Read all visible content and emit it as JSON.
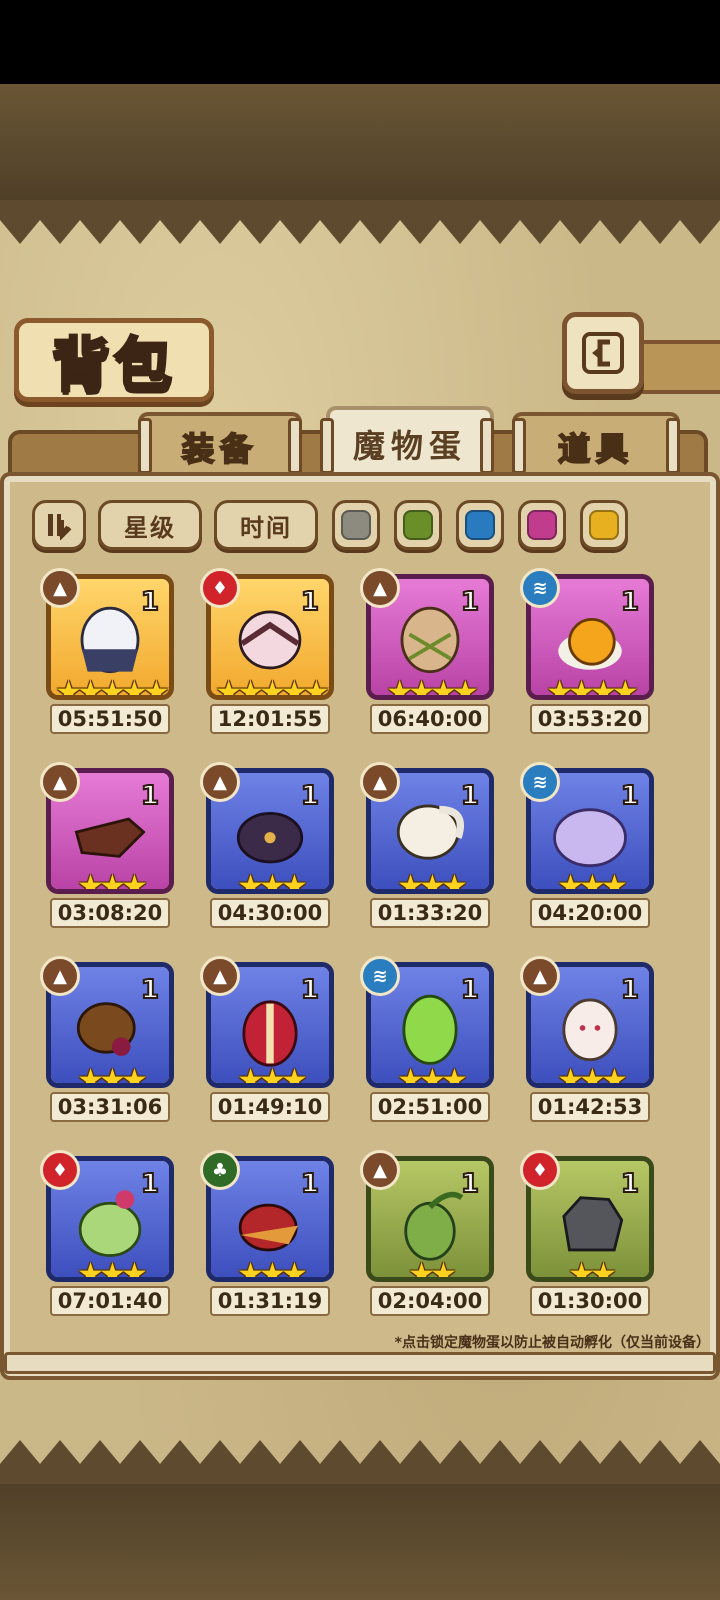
{
  "title": "背包",
  "tabs": [
    {
      "label": "装备",
      "active": false
    },
    {
      "label": "魔物蛋",
      "active": true
    },
    {
      "label": "道具",
      "active": false
    }
  ],
  "filters": {
    "sort_icon": "sort-toggle-icon",
    "star_label": "星级",
    "time_label": "时间",
    "color_swatches": [
      "#8d8a80",
      "#6b8f28",
      "#2a7ac0",
      "#c23c8e",
      "#e6b020"
    ]
  },
  "eggs": [
    {
      "element": "earth",
      "rarity": "gold",
      "count": "1",
      "stars": "★★★★★",
      "timer": "05:51:50"
    },
    {
      "element": "fire",
      "rarity": "gold",
      "count": "1",
      "stars": "★★★★★",
      "timer": "12:01:55"
    },
    {
      "element": "earth",
      "rarity": "purple",
      "count": "1",
      "stars": "★★★★",
      "timer": "06:40:00"
    },
    {
      "element": "water",
      "rarity": "purple",
      "count": "1",
      "stars": "★★★★",
      "timer": "03:53:20"
    },
    {
      "element": "earth",
      "rarity": "purple",
      "count": "1",
      "stars": "★★★",
      "timer": "03:08:20"
    },
    {
      "element": "earth",
      "rarity": "blue",
      "count": "1",
      "stars": "★★★",
      "timer": "04:30:00"
    },
    {
      "element": "earth",
      "rarity": "blue",
      "count": "1",
      "stars": "★★★",
      "timer": "01:33:20"
    },
    {
      "element": "water",
      "rarity": "blue",
      "count": "1",
      "stars": "★★★",
      "timer": "04:20:00"
    },
    {
      "element": "earth",
      "rarity": "blue",
      "count": "1",
      "stars": "★★★",
      "timer": "03:31:06"
    },
    {
      "element": "earth",
      "rarity": "blue",
      "count": "1",
      "stars": "★★★",
      "timer": "01:49:10"
    },
    {
      "element": "water",
      "rarity": "blue",
      "count": "1",
      "stars": "★★★",
      "timer": "02:51:00"
    },
    {
      "element": "earth",
      "rarity": "blue",
      "count": "1",
      "stars": "★★★",
      "timer": "01:42:53"
    },
    {
      "element": "fire",
      "rarity": "blue",
      "count": "1",
      "stars": "★★★",
      "timer": "07:01:40"
    },
    {
      "element": "wood",
      "rarity": "blue",
      "count": "1",
      "stars": "★★★",
      "timer": "01:31:19"
    },
    {
      "element": "earth",
      "rarity": "green",
      "count": "1",
      "stars": "★★",
      "timer": "02:04:00"
    },
    {
      "element": "fire",
      "rarity": "green",
      "count": "1",
      "stars": "★★",
      "timer": "01:30:00"
    }
  ],
  "footnote": "*点击锁定魔物蛋以防止被自动孵化（仅当前设备）"
}
